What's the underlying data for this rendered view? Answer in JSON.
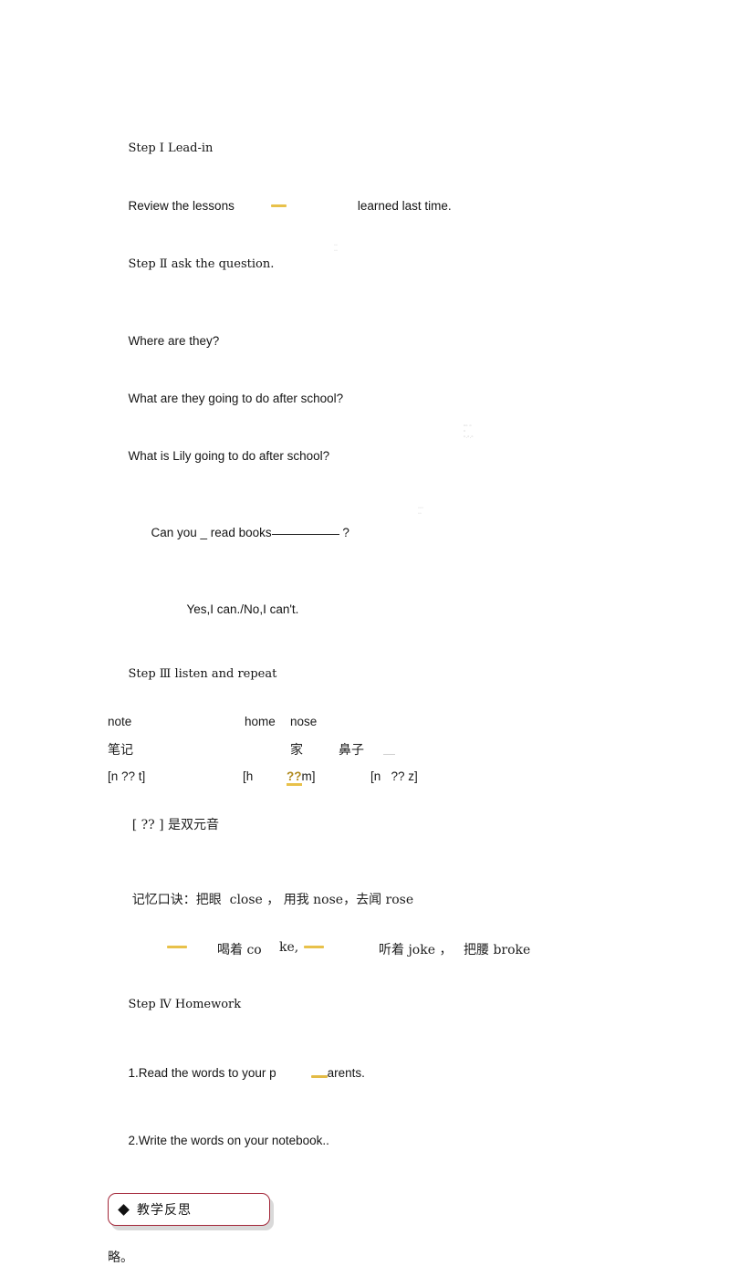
{
  "document": {
    "type": "lesson-plan-scan",
    "page_background": "#ffffff",
    "text_color": "#141414",
    "highlight_color": "#e8c14a",
    "reflection_border_color": "#a32638"
  },
  "lesson": {
    "step1": {
      "heading": "Step Ⅰ Lead-in",
      "review_before": "Review the lessons",
      "review_after": "learned last time."
    },
    "step2": {
      "heading": "Step Ⅱ ask the question.",
      "questions": [
        "Where are they?",
        "What are they going to do after school?",
        "What is Lily going to do after school?"
      ],
      "prompt_before": "Can you _ read books",
      "prompt_after": "?",
      "answer": "Yes,I can./No,I can't."
    },
    "step3": {
      "heading": "Step Ⅲ listen and repeat",
      "words": {
        "word1": "note",
        "word2": "home",
        "word3": "nose"
      },
      "meanings": {
        "meaning1": "笔记",
        "meaning2": "家",
        "meaning3": "鼻子"
      },
      "phonetics": {
        "p1": "[n ?? t]",
        "p2_open": "[h",
        "p2_vowel": "??",
        "p2_close": "m]",
        "p3": "[n   ?? z]"
      },
      "vowel_note": "[ ?? ] 是双元音",
      "mnemonic_line1": "记忆口诀：把眼  close ， 用我 nose，去闻 rose",
      "mnemonic_line2": {
        "seg1": "喝着 co",
        "seg2": "ke,",
        "seg3": "听着 joke ，",
        "seg4": "把腰 broke"
      }
    },
    "step4": {
      "heading": "Step Ⅳ Homework",
      "item1_before": "1.Read the words to your p",
      "item1_after": "arents.",
      "item2": "2.Write the words on your notebook.."
    },
    "reflection": {
      "bullet": "◆",
      "label": "教学反思",
      "note": "略。"
    }
  },
  "artifacts": {
    "smudge1": "scan-smudge",
    "smudge2": "scan-smudge",
    "smudge3": "scan-smudge"
  }
}
